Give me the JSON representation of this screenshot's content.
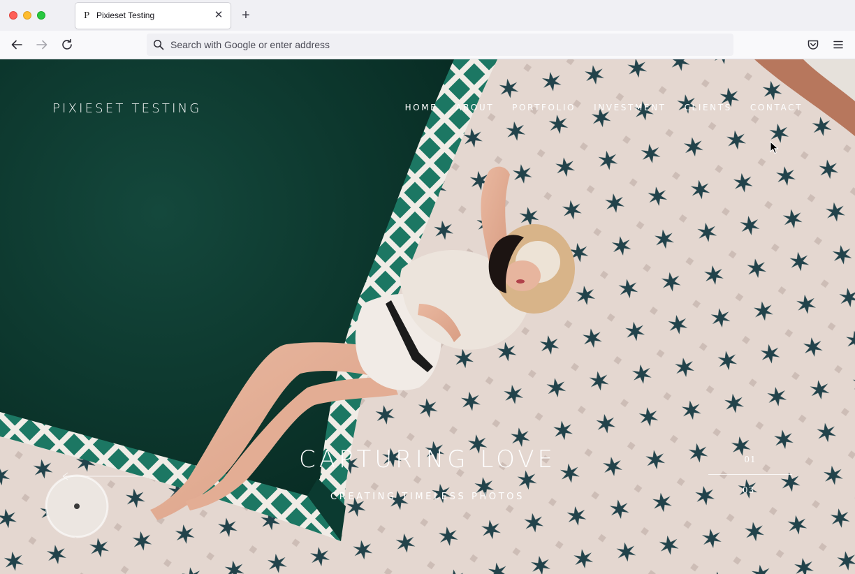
{
  "browser": {
    "tab": {
      "title": "Pixieset Testing",
      "favicon": "P"
    },
    "new_tab_icon": "plus-icon",
    "address_bar": {
      "placeholder": "Search with Google or enter address"
    },
    "icons": [
      "back-arrow-icon",
      "forward-arrow-icon",
      "reload-icon",
      "search-icon",
      "pocket-icon",
      "hamburger-menu-icon"
    ]
  },
  "site": {
    "title": "PIXIESET TESTING",
    "nav": [
      {
        "label": "HOME"
      },
      {
        "label": "ABOUT"
      },
      {
        "label": "PORTFOLIO"
      },
      {
        "label": "INVESTMENT"
      },
      {
        "label": "CLIENTS"
      },
      {
        "label": "CONTACT"
      }
    ],
    "hero": {
      "title": "CAPTURING LOVE",
      "subtitle": "CREATING TIMELESS PHOTOS",
      "slide_current": "01",
      "slide_total": "03"
    }
  },
  "colors": {
    "pool": "#0e3b31",
    "tile": "#e3d6cf",
    "star": "#21424a",
    "border_teal": "#1f7a66"
  }
}
